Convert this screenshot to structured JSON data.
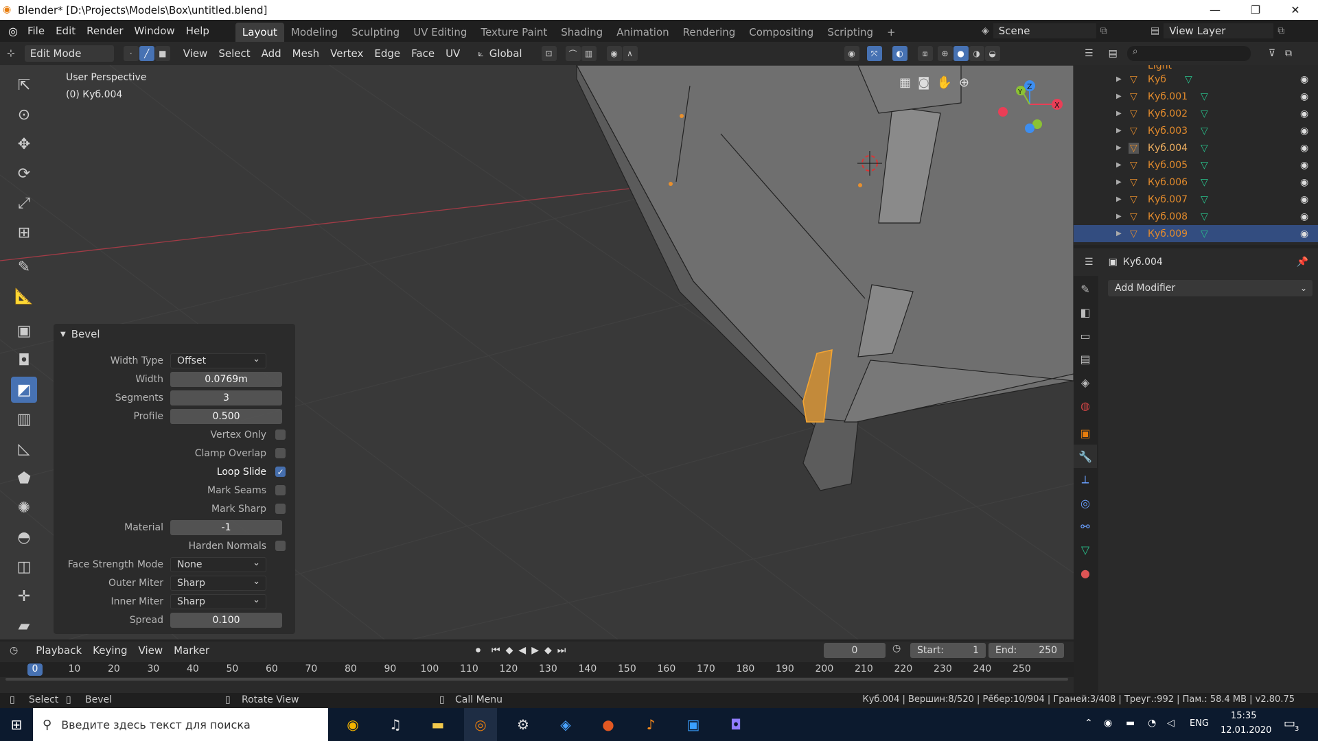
{
  "window": {
    "title": "Blender* [D:\\Projects\\Models\\Box\\untitled.blend]",
    "min": "—",
    "max": "❐",
    "close": "✕"
  },
  "topmenu": [
    "File",
    "Edit",
    "Render",
    "Window",
    "Help"
  ],
  "workspaces": [
    "Layout",
    "Modeling",
    "Sculpting",
    "UV Editing",
    "Texture Paint",
    "Shading",
    "Animation",
    "Rendering",
    "Compositing",
    "Scripting",
    "+"
  ],
  "scene": {
    "label": "Scene",
    "view_layer": "View Layer"
  },
  "viewport_header": {
    "mode": "Edit Mode",
    "menus": [
      "View",
      "Select",
      "Add",
      "Mesh",
      "Vertex",
      "Edge",
      "Face",
      "UV"
    ],
    "orientation": "Global"
  },
  "viewport": {
    "perspective": "User Perspective",
    "object": "(0) Куб.004",
    "axis_x": "X",
    "axis_y": "Y",
    "axis_z": "Z"
  },
  "bevel": {
    "title": "Bevel",
    "width_type": {
      "label": "Width Type",
      "value": "Offset"
    },
    "width": {
      "label": "Width",
      "value": "0.0769m"
    },
    "segments": {
      "label": "Segments",
      "value": "3"
    },
    "profile": {
      "label": "Profile",
      "value": "0.500"
    },
    "vertex_only": {
      "label": "Vertex Only"
    },
    "clamp_overlap": {
      "label": "Clamp Overlap"
    },
    "loop_slide": {
      "label": "Loop Slide",
      "check": "✓"
    },
    "mark_seams": {
      "label": "Mark Seams"
    },
    "mark_sharp": {
      "label": "Mark Sharp"
    },
    "material": {
      "label": "Material",
      "value": "-1"
    },
    "harden_normals": {
      "label": "Harden Normals"
    },
    "face_strength": {
      "label": "Face Strength Mode",
      "value": "None"
    },
    "outer_miter": {
      "label": "Outer Miter",
      "value": "Sharp"
    },
    "inner_miter": {
      "label": "Inner Miter",
      "value": "Sharp"
    },
    "spread": {
      "label": "Spread",
      "value": "0.100"
    }
  },
  "outliner": {
    "partial": "Light",
    "items": [
      "Куб",
      "Куб.001",
      "Куб.002",
      "Куб.003",
      "Куб.004",
      "Куб.005",
      "Куб.006",
      "Куб.007",
      "Куб.008",
      "Куб.009"
    ]
  },
  "properties": {
    "object": "Куб.004",
    "add_modifier": "Add Modifier"
  },
  "timeline": {
    "menus": [
      "Playback",
      "Keying",
      "View",
      "Marker"
    ],
    "current_frame": "0",
    "start_label": "Start:",
    "start": "1",
    "end_label": "End:",
    "end": "250",
    "ruler": [
      "0",
      "10",
      "20",
      "30",
      "40",
      "50",
      "60",
      "70",
      "80",
      "90",
      "100",
      "110",
      "120",
      "130",
      "140",
      "150",
      "160",
      "170",
      "180",
      "190",
      "200",
      "210",
      "220",
      "230",
      "240",
      "250"
    ]
  },
  "statusbar": {
    "select": "Select",
    "bevel": "Bevel",
    "rotate": "Rotate View",
    "call_menu": "Call Menu",
    "stats": "Куб.004 | Вершин:8/520 | Рёбер:10/904 | Граней:3/408 | Треуг.:992 | Пам.: 58.4 MB | v2.80.75"
  },
  "taskbar": {
    "search": "Введите здесь текст для поиска",
    "lang": "ENG",
    "time": "15:35",
    "date": "12.01.2020",
    "notif": "3"
  },
  "colors": {
    "accent": "#4772b3",
    "object_orange": "#e38b2c",
    "mesh_green": "#28c28c",
    "x_axis": "#ea3e56",
    "y_axis": "#8bc234",
    "z_axis": "#3d8ef0"
  }
}
